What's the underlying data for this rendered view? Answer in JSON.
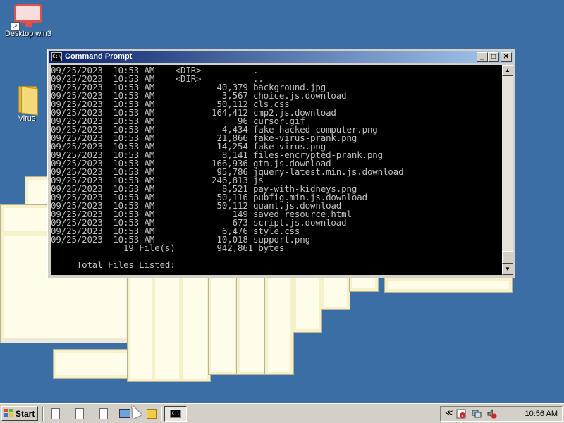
{
  "desktop": {
    "icons": [
      {
        "label": "Desktop win3",
        "icon": "monitor-shortcut-icon"
      },
      {
        "label": "Virus",
        "icon": "folder-icon"
      }
    ]
  },
  "window": {
    "title": "Command Prompt",
    "icon_text": "C:\\",
    "minimize": "_",
    "maximize": "□",
    "close": "✕"
  },
  "console": {
    "lines": [
      "09/25/2023  10:53 AM    <DIR>          .",
      "09/25/2023  10:53 AM    <DIR>          ..",
      "09/25/2023  10:53 AM            40,379 background.jpg",
      "09/25/2023  10:53 AM             3,567 choice.js.download",
      "09/25/2023  10:53 AM            50,112 cls.css",
      "09/25/2023  10:53 AM           164,412 cmp2.js.download",
      "09/25/2023  10:53 AM                96 cursor.gif",
      "09/25/2023  10:53 AM             4,434 fake-hacked-computer.png",
      "09/25/2023  10:53 AM            21,866 fake-virus-prank.png",
      "09/25/2023  10:53 AM            14,254 fake-virus.png",
      "09/25/2023  10:53 AM             8,141 files-encrypted-prank.png",
      "09/25/2023  10:53 AM           166,936 gtm.js.download",
      "09/25/2023  10:53 AM            95,786 jquery-latest.min.js.download",
      "09/25/2023  10:53 AM           246,813 js",
      "09/25/2023  10:53 AM             8,521 pay-with-kidneys.png",
      "09/25/2023  10:53 AM            50,116 pubfig.min.js.download",
      "09/25/2023  10:53 AM            50,112 quant.js.download",
      "09/25/2023  10:53 AM               149 saved_resource.html",
      "09/25/2023  10:53 AM               673 script.js.download",
      "09/25/2023  10:53 AM             6,476 style.css",
      "09/25/2023  10:53 AM            10,018 support.png",
      "              19 File(s)        942,861 bytes",
      "",
      "     Total Files Listed:"
    ]
  },
  "taskbar": {
    "start_label": "Start",
    "clock": "10:56 AM",
    "tray_chevron": "≪",
    "task_icon_text": "C:\\"
  },
  "colors": {
    "desktop": "#3a6ea5",
    "title_start": "#0a246a",
    "title_end": "#a6caf0",
    "console_bg": "#000000",
    "console_fg": "#c0c0c0"
  }
}
